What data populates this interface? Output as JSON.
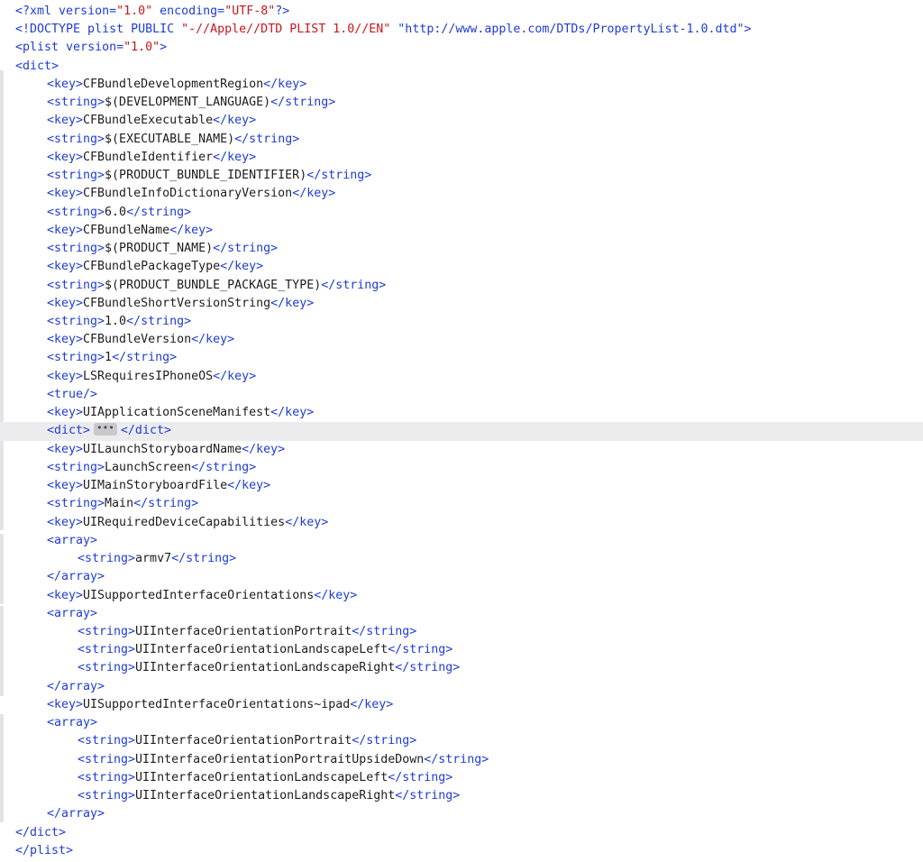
{
  "editor": {
    "fold_placeholder": "•••",
    "highlighted_line": 19,
    "lines": [
      {
        "indent": 0,
        "tokens": [
          {
            "t": "tag",
            "v": "<?xml "
          },
          {
            "t": "tag",
            "v": "version="
          },
          {
            "t": "str",
            "v": "\"1.0\""
          },
          {
            "t": "tag",
            "v": " encoding="
          },
          {
            "t": "str",
            "v": "\"UTF-8\""
          },
          {
            "t": "tag",
            "v": "?>"
          }
        ]
      },
      {
        "indent": 0,
        "tokens": [
          {
            "t": "tag",
            "v": "<!DOCTYPE plist PUBLIC "
          },
          {
            "t": "str",
            "v": "\"-//Apple//DTD PLIST 1.0//EN\""
          },
          {
            "t": "tag",
            "v": " \"http://www.apple.com/DTDs/PropertyList-1.0.dtd\">"
          }
        ]
      },
      {
        "indent": 0,
        "tokens": [
          {
            "t": "tag",
            "v": "<plist "
          },
          {
            "t": "tag",
            "v": "version="
          },
          {
            "t": "str",
            "v": "\"1.0\""
          },
          {
            "t": "tag",
            "v": ">"
          }
        ]
      },
      {
        "indent": 0,
        "tokens": [
          {
            "t": "tag",
            "v": "<dict>"
          }
        ]
      },
      {
        "indent": 1,
        "tokens": [
          {
            "t": "tag",
            "v": "<key>"
          },
          {
            "t": "text",
            "v": "CFBundleDevelopmentRegion"
          },
          {
            "t": "tag",
            "v": "</key>"
          }
        ]
      },
      {
        "indent": 1,
        "tokens": [
          {
            "t": "tag",
            "v": "<string>"
          },
          {
            "t": "text",
            "v": "$(DEVELOPMENT_LANGUAGE)"
          },
          {
            "t": "tag",
            "v": "</string>"
          }
        ]
      },
      {
        "indent": 1,
        "tokens": [
          {
            "t": "tag",
            "v": "<key>"
          },
          {
            "t": "text",
            "v": "CFBundleExecutable"
          },
          {
            "t": "tag",
            "v": "</key>"
          }
        ]
      },
      {
        "indent": 1,
        "tokens": [
          {
            "t": "tag",
            "v": "<string>"
          },
          {
            "t": "text",
            "v": "$(EXECUTABLE_NAME)"
          },
          {
            "t": "tag",
            "v": "</string>"
          }
        ]
      },
      {
        "indent": 1,
        "tokens": [
          {
            "t": "tag",
            "v": "<key>"
          },
          {
            "t": "text",
            "v": "CFBundleIdentifier"
          },
          {
            "t": "tag",
            "v": "</key>"
          }
        ]
      },
      {
        "indent": 1,
        "tokens": [
          {
            "t": "tag",
            "v": "<string>"
          },
          {
            "t": "text",
            "v": "$(PRODUCT_BUNDLE_IDENTIFIER)"
          },
          {
            "t": "tag",
            "v": "</string>"
          }
        ]
      },
      {
        "indent": 1,
        "tokens": [
          {
            "t": "tag",
            "v": "<key>"
          },
          {
            "t": "text",
            "v": "CFBundleInfoDictionaryVersion"
          },
          {
            "t": "tag",
            "v": "</key>"
          }
        ]
      },
      {
        "indent": 1,
        "tokens": [
          {
            "t": "tag",
            "v": "<string>"
          },
          {
            "t": "text",
            "v": "6.0"
          },
          {
            "t": "tag",
            "v": "</string>"
          }
        ]
      },
      {
        "indent": 1,
        "tokens": [
          {
            "t": "tag",
            "v": "<key>"
          },
          {
            "t": "text",
            "v": "CFBundleName"
          },
          {
            "t": "tag",
            "v": "</key>"
          }
        ]
      },
      {
        "indent": 1,
        "tokens": [
          {
            "t": "tag",
            "v": "<string>"
          },
          {
            "t": "text",
            "v": "$(PRODUCT_NAME)"
          },
          {
            "t": "tag",
            "v": "</string>"
          }
        ]
      },
      {
        "indent": 1,
        "tokens": [
          {
            "t": "tag",
            "v": "<key>"
          },
          {
            "t": "text",
            "v": "CFBundlePackageType"
          },
          {
            "t": "tag",
            "v": "</key>"
          }
        ]
      },
      {
        "indent": 1,
        "tokens": [
          {
            "t": "tag",
            "v": "<string>"
          },
          {
            "t": "text",
            "v": "$(PRODUCT_BUNDLE_PACKAGE_TYPE)"
          },
          {
            "t": "tag",
            "v": "</string>"
          }
        ]
      },
      {
        "indent": 1,
        "tokens": [
          {
            "t": "tag",
            "v": "<key>"
          },
          {
            "t": "text",
            "v": "CFBundleShortVersionString"
          },
          {
            "t": "tag",
            "v": "</key>"
          }
        ]
      },
      {
        "indent": 1,
        "tokens": [
          {
            "t": "tag",
            "v": "<string>"
          },
          {
            "t": "text",
            "v": "1.0"
          },
          {
            "t": "tag",
            "v": "</string>"
          }
        ]
      },
      {
        "indent": 1,
        "tokens": [
          {
            "t": "tag",
            "v": "<key>"
          },
          {
            "t": "text",
            "v": "CFBundleVersion"
          },
          {
            "t": "tag",
            "v": "</key>"
          }
        ]
      },
      {
        "indent": 1,
        "tokens": [
          {
            "t": "tag",
            "v": "<string>"
          },
          {
            "t": "text",
            "v": "1"
          },
          {
            "t": "tag",
            "v": "</string>"
          }
        ]
      },
      {
        "indent": 1,
        "tokens": [
          {
            "t": "tag",
            "v": "<key>"
          },
          {
            "t": "text",
            "v": "LSRequiresIPhoneOS"
          },
          {
            "t": "tag",
            "v": "</key>"
          }
        ]
      },
      {
        "indent": 1,
        "tokens": [
          {
            "t": "tag",
            "v": "<true/>"
          }
        ]
      },
      {
        "indent": 1,
        "tokens": [
          {
            "t": "tag",
            "v": "<key>"
          },
          {
            "t": "text",
            "v": "UIApplicationSceneManifest"
          },
          {
            "t": "tag",
            "v": "</key>"
          }
        ]
      },
      {
        "indent": 1,
        "tokens": [
          {
            "t": "tag",
            "v": "<dict>"
          },
          {
            "t": "fold",
            "v": "•••"
          },
          {
            "t": "tag",
            "v": "</dict>"
          }
        ]
      },
      {
        "indent": 1,
        "tokens": [
          {
            "t": "tag",
            "v": "<key>"
          },
          {
            "t": "text",
            "v": "UILaunchStoryboardName"
          },
          {
            "t": "tag",
            "v": "</key>"
          }
        ]
      },
      {
        "indent": 1,
        "tokens": [
          {
            "t": "tag",
            "v": "<string>"
          },
          {
            "t": "text",
            "v": "LaunchScreen"
          },
          {
            "t": "tag",
            "v": "</string>"
          }
        ]
      },
      {
        "indent": 1,
        "tokens": [
          {
            "t": "tag",
            "v": "<key>"
          },
          {
            "t": "text",
            "v": "UIMainStoryboardFile"
          },
          {
            "t": "tag",
            "v": "</key>"
          }
        ]
      },
      {
        "indent": 1,
        "tokens": [
          {
            "t": "tag",
            "v": "<string>"
          },
          {
            "t": "text",
            "v": "Main"
          },
          {
            "t": "tag",
            "v": "</string>"
          }
        ]
      },
      {
        "indent": 1,
        "tokens": [
          {
            "t": "tag",
            "v": "<key>"
          },
          {
            "t": "text",
            "v": "UIRequiredDeviceCapabilities"
          },
          {
            "t": "tag",
            "v": "</key>"
          }
        ]
      },
      {
        "indent": 1,
        "tokens": [
          {
            "t": "tag",
            "v": "<array>"
          }
        ]
      },
      {
        "indent": 2,
        "tokens": [
          {
            "t": "tag",
            "v": "<string>"
          },
          {
            "t": "text",
            "v": "armv7"
          },
          {
            "t": "tag",
            "v": "</string>"
          }
        ]
      },
      {
        "indent": 1,
        "tokens": [
          {
            "t": "tag",
            "v": "</array>"
          }
        ]
      },
      {
        "indent": 1,
        "tokens": [
          {
            "t": "tag",
            "v": "<key>"
          },
          {
            "t": "text",
            "v": "UISupportedInterfaceOrientations"
          },
          {
            "t": "tag",
            "v": "</key>"
          }
        ]
      },
      {
        "indent": 1,
        "tokens": [
          {
            "t": "tag",
            "v": "<array>"
          }
        ]
      },
      {
        "indent": 2,
        "tokens": [
          {
            "t": "tag",
            "v": "<string>"
          },
          {
            "t": "text",
            "v": "UIInterfaceOrientationPortrait"
          },
          {
            "t": "tag",
            "v": "</string>"
          }
        ]
      },
      {
        "indent": 2,
        "tokens": [
          {
            "t": "tag",
            "v": "<string>"
          },
          {
            "t": "text",
            "v": "UIInterfaceOrientationLandscapeLeft"
          },
          {
            "t": "tag",
            "v": "</string>"
          }
        ]
      },
      {
        "indent": 2,
        "tokens": [
          {
            "t": "tag",
            "v": "<string>"
          },
          {
            "t": "text",
            "v": "UIInterfaceOrientationLandscapeRight"
          },
          {
            "t": "tag",
            "v": "</string>"
          }
        ]
      },
      {
        "indent": 1,
        "tokens": [
          {
            "t": "tag",
            "v": "</array>"
          }
        ]
      },
      {
        "indent": 1,
        "tokens": [
          {
            "t": "tag",
            "v": "<key>"
          },
          {
            "t": "text",
            "v": "UISupportedInterfaceOrientations~ipad"
          },
          {
            "t": "tag",
            "v": "</key>"
          }
        ]
      },
      {
        "indent": 1,
        "tokens": [
          {
            "t": "tag",
            "v": "<array>"
          }
        ]
      },
      {
        "indent": 2,
        "tokens": [
          {
            "t": "tag",
            "v": "<string>"
          },
          {
            "t": "text",
            "v": "UIInterfaceOrientationPortrait"
          },
          {
            "t": "tag",
            "v": "</string>"
          }
        ]
      },
      {
        "indent": 2,
        "tokens": [
          {
            "t": "tag",
            "v": "<string>"
          },
          {
            "t": "text",
            "v": "UIInterfaceOrientationPortraitUpsideDown"
          },
          {
            "t": "tag",
            "v": "</string>"
          }
        ]
      },
      {
        "indent": 2,
        "tokens": [
          {
            "t": "tag",
            "v": "<string>"
          },
          {
            "t": "text",
            "v": "UIInterfaceOrientationLandscapeLeft"
          },
          {
            "t": "tag",
            "v": "</string>"
          }
        ]
      },
      {
        "indent": 2,
        "tokens": [
          {
            "t": "tag",
            "v": "<string>"
          },
          {
            "t": "text",
            "v": "UIInterfaceOrientationLandscapeRight"
          },
          {
            "t": "tag",
            "v": "</string>"
          }
        ]
      },
      {
        "indent": 1,
        "tokens": [
          {
            "t": "tag",
            "v": "</array>"
          }
        ]
      },
      {
        "indent": 0,
        "tokens": [
          {
            "t": "tag",
            "v": "</dict>"
          }
        ]
      },
      {
        "indent": 0,
        "tokens": [
          {
            "t": "tag",
            "v": "</plist>"
          }
        ]
      }
    ]
  },
  "colors": {
    "tag": "#1f3cd6",
    "string_literal": "#c8161e",
    "text": "#1d1d1f",
    "highlight": "#ececee",
    "fold_badge": "#c9c9cd"
  }
}
